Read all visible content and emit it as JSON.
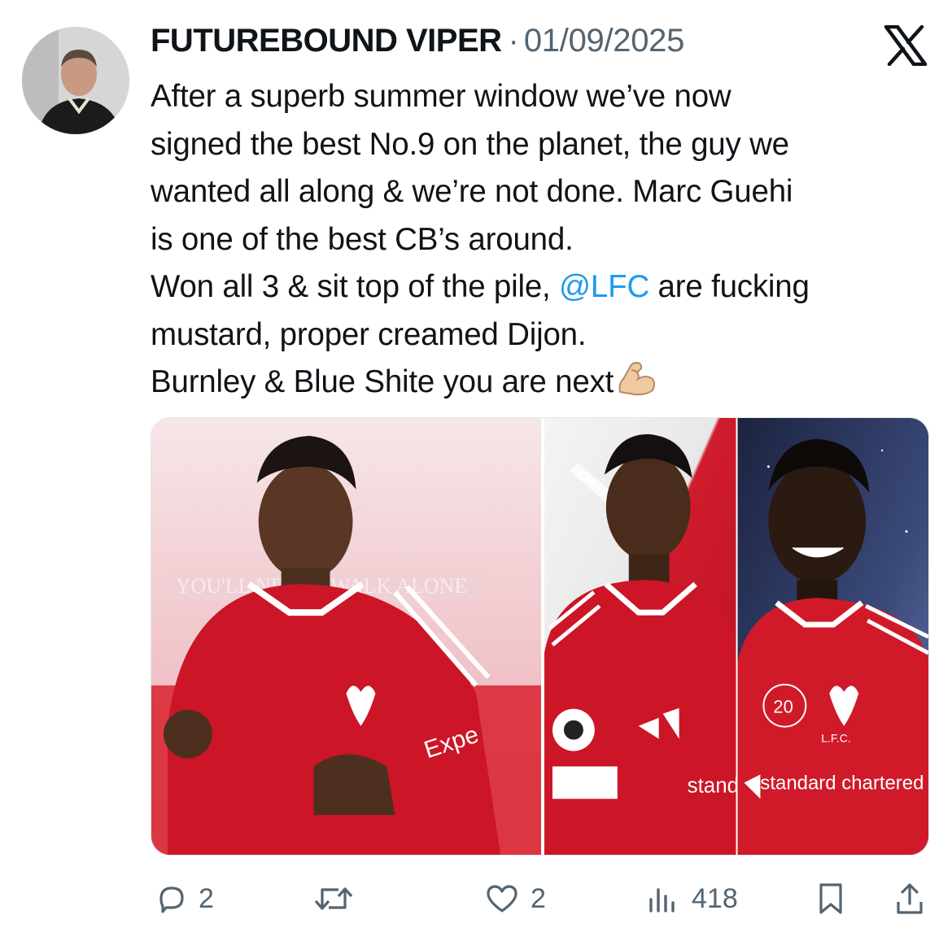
{
  "tweet": {
    "author": "FUTUREBOUND VIPER",
    "separator": "·",
    "date": "01/09/2025",
    "text_lines": [
      "After a superb summer window we’ve now",
      "signed the best No.9 on the planet, the guy we",
      "wanted all along & we’re not done. Marc Guehi",
      "is one of the best CB’s around."
    ],
    "line5_before": "Won all 3 & sit top of the pile, ",
    "mention": "@LFC",
    "line5_after": " are fucking",
    "line6": "mustard, proper creamed Dijon.",
    "line7": "Burnley & Blue Shite you are next",
    "emoji": "flexed-biceps",
    "media": {
      "left_image_text": "YOU'LL NEVER WALK ALONE",
      "left_sponsor": "Expe",
      "middle_sponsor": "stand chat",
      "right_sponsor": "standard chartered",
      "right_crest_text": "L.F.C.",
      "right_number": "20"
    }
  },
  "actions": {
    "replies": "2",
    "reposts": "",
    "likes": "2",
    "views": "418"
  },
  "colors": {
    "text": "#0f1419",
    "secondary": "#536471",
    "link": "#1d9bf0",
    "kit_red": "#c8102e"
  },
  "icons": [
    "x-logo-icon",
    "reply-icon",
    "repost-icon",
    "like-icon",
    "views-icon",
    "bookmark-icon",
    "share-icon",
    "flexed-biceps-emoji"
  ]
}
